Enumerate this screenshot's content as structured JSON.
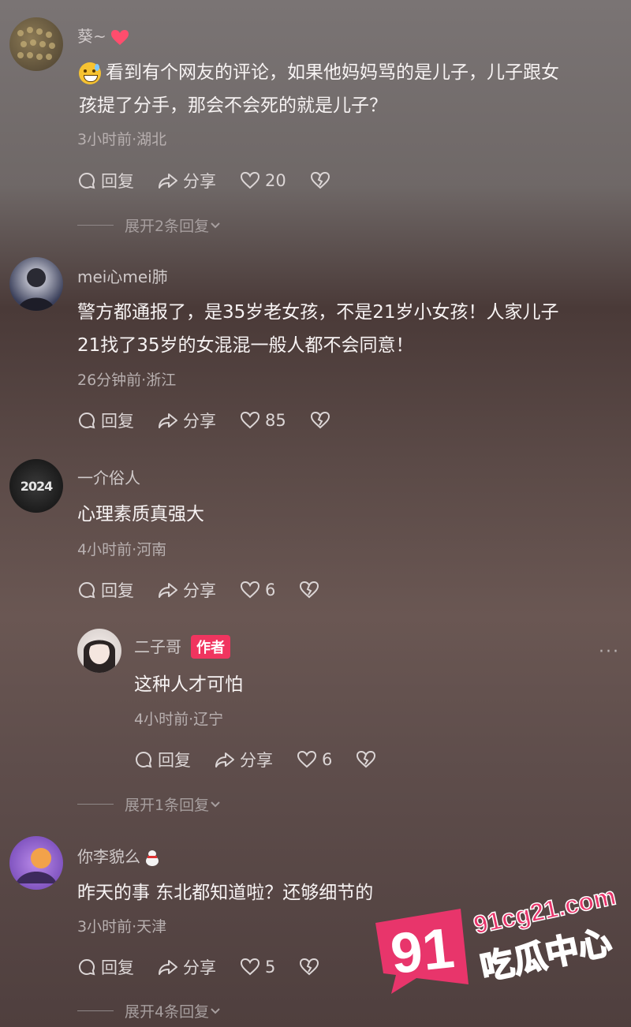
{
  "actions": {
    "reply": "回复",
    "share": "分享"
  },
  "comments": [
    {
      "user": "葵~",
      "text_lines": [
        "看到有个网友的评论，如果他妈妈骂的是儿子，儿子跟女",
        "孩提了分手，那会不会死的就是儿子？"
      ],
      "meta": "3小时前·湖北",
      "likes": "20",
      "expand": "展开2条回复"
    },
    {
      "user": "mei心mei肺",
      "text_lines": [
        "警方都通报了，是35岁老女孩，不是21岁小女孩！人家儿子",
        "21找了35岁的女混混一般人都不会同意！"
      ],
      "meta": "26分钟前·浙江",
      "likes": "85"
    },
    {
      "user": "一介俗人",
      "text_lines": [
        "心理素质真强大"
      ],
      "meta": "4小时前·河南",
      "likes": "6",
      "avatar_text": "2024"
    },
    {
      "user": "你李貌么",
      "text_lines": [
        "昨天的事 东北都知道啦？还够细节的"
      ],
      "meta": "3小时前·天津",
      "likes": "5",
      "expand": "展开4条回复"
    }
  ],
  "reply": {
    "user": "二子哥",
    "badge": "作者",
    "text": "这种人才可怕",
    "meta": "4小时前·辽宁",
    "likes": "6",
    "expand": "展开1条回复",
    "more": "···"
  },
  "watermark": {
    "number": "91",
    "domain": "91cg21.com",
    "name": "吃瓜中心"
  },
  "colors": {
    "accent": "#f0355f",
    "heart": "#ff4d6d"
  }
}
